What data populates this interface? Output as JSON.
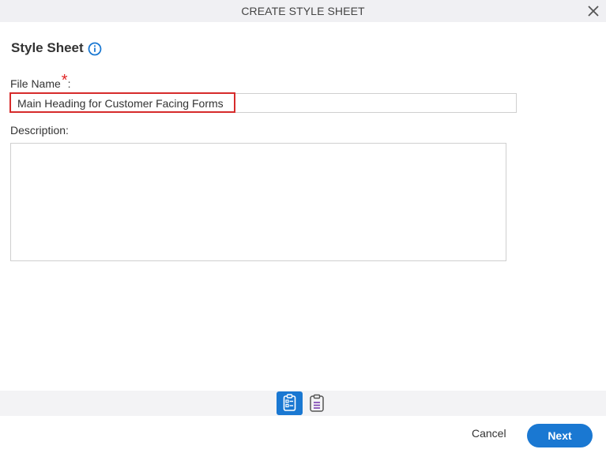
{
  "dialog": {
    "title": "CREATE STYLE SHEET",
    "close_icon": "close-icon"
  },
  "section": {
    "title": "Style Sheet",
    "info_icon": "info-icon"
  },
  "form": {
    "file_name_label": "File Name",
    "required_marker": "*",
    "colon": ":",
    "file_name_value": "Main Heading for Customer Facing Forms",
    "description_label": "Description:",
    "description_value": ""
  },
  "steps": [
    {
      "icon": "form-steps-icon",
      "active": true
    },
    {
      "icon": "clipboard-icon",
      "active": false
    }
  ],
  "footer": {
    "cancel_label": "Cancel",
    "next_label": "Next"
  },
  "colors": {
    "accent": "#1a78d2",
    "required": "#e02424",
    "highlight": "#d62b2b"
  }
}
